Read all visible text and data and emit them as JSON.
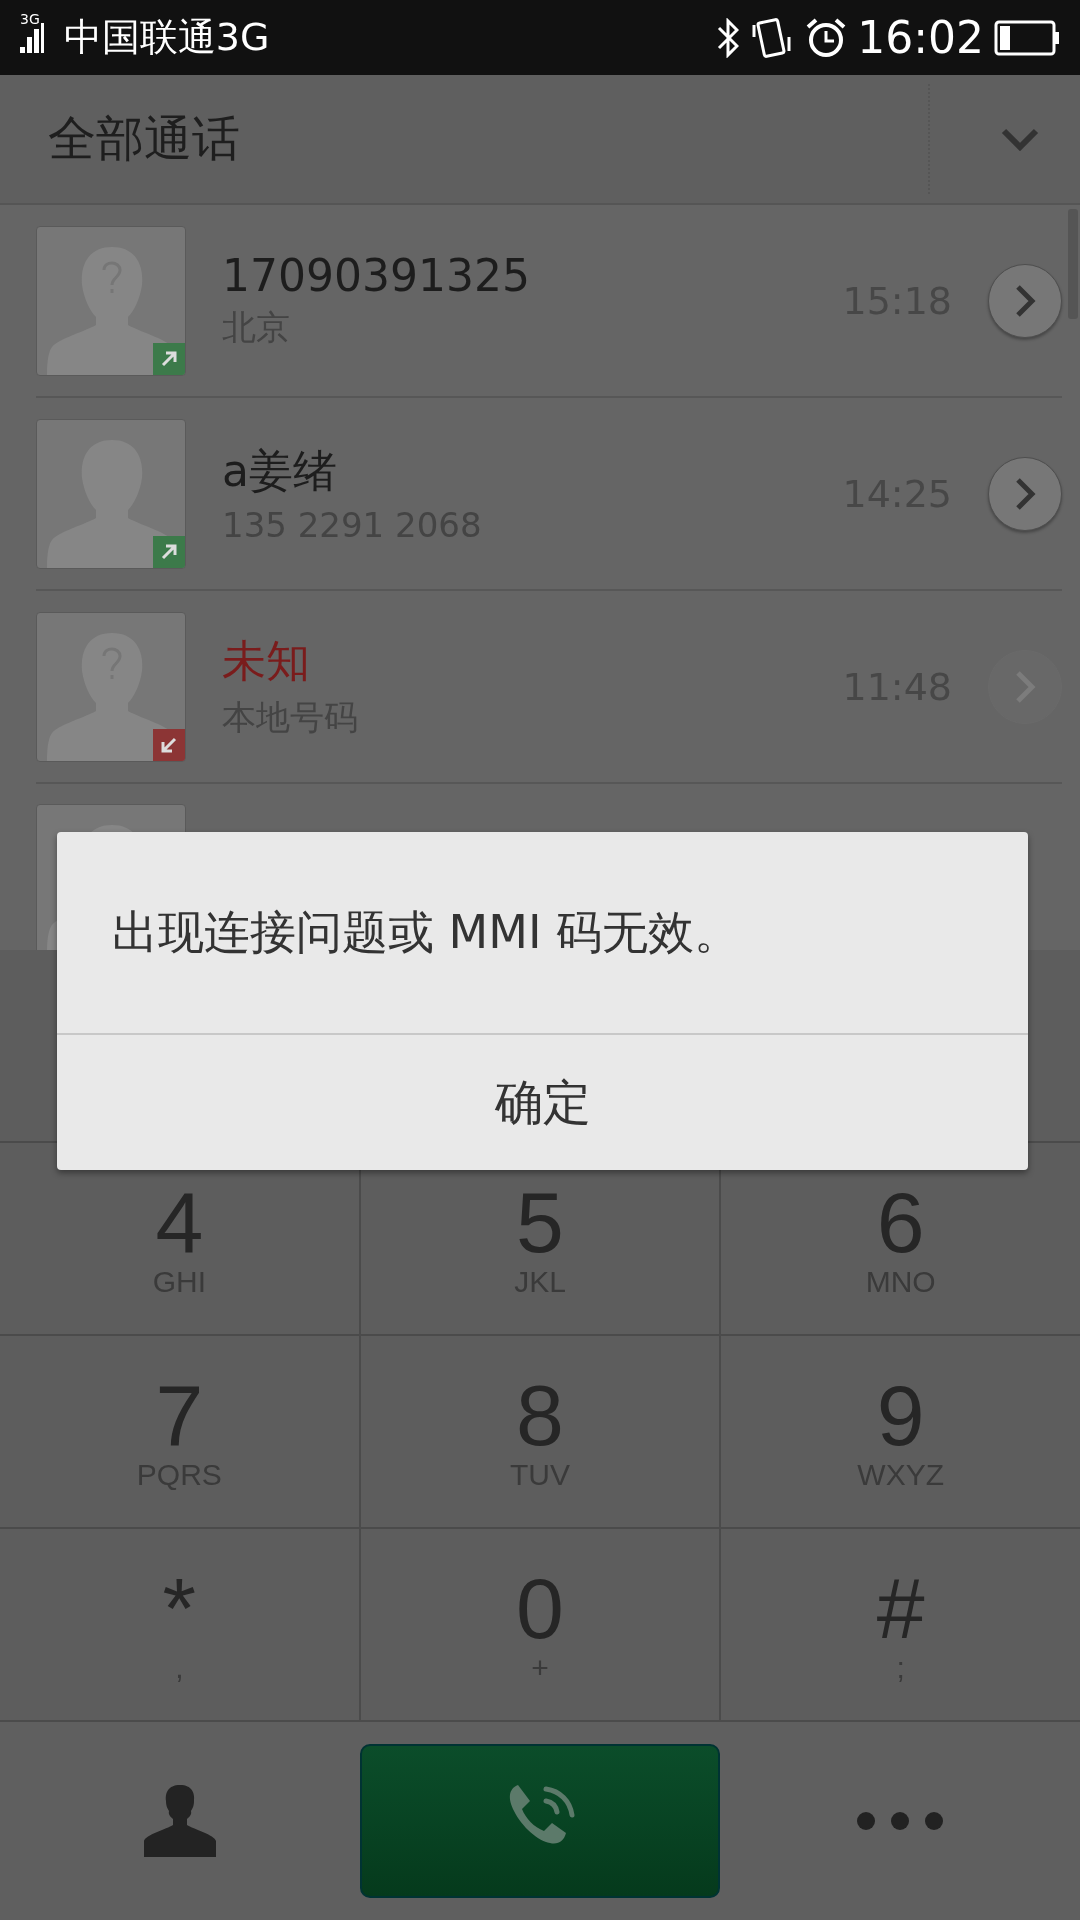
{
  "status_bar": {
    "network": "3G",
    "carrier": "中国联通3G",
    "time": "16:02"
  },
  "header": {
    "title": "全部通话"
  },
  "calls": [
    {
      "name": "17090391325",
      "detail": "北京",
      "time": "15:18",
      "kind": "outgoing",
      "unknown_contact": true,
      "detail_disabled": false
    },
    {
      "name": "a姜绪",
      "detail": "135 2291 2068",
      "time": "14:25",
      "kind": "outgoing",
      "unknown_contact": false,
      "detail_disabled": false
    },
    {
      "name": "未知",
      "detail": "本地号码",
      "time": "11:48",
      "kind": "missed",
      "unknown_contact": true,
      "detail_disabled": true
    },
    {
      "kind": "hidden"
    }
  ],
  "keypad": [
    {
      "digit": "4",
      "letters": "GHI"
    },
    {
      "digit": "5",
      "letters": "JKL"
    },
    {
      "digit": "6",
      "letters": "MNO"
    },
    {
      "digit": "7",
      "letters": "PQRS"
    },
    {
      "digit": "8",
      "letters": "TUV"
    },
    {
      "digit": "9",
      "letters": "WXYZ"
    },
    {
      "digit": "*",
      "letters": ","
    },
    {
      "digit": "0",
      "letters": "+"
    },
    {
      "digit": "#",
      "letters": ";"
    }
  ],
  "dialog": {
    "message": "出现连接问题或 MMI 码无效。",
    "button": "确定"
  }
}
